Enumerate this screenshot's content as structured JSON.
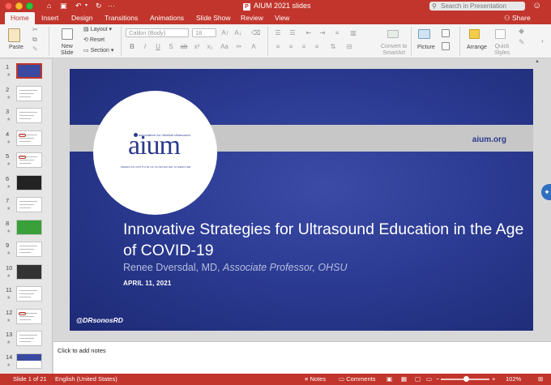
{
  "window": {
    "title": "AIUM 2021 slides",
    "search_placeholder": "Search in Presentation"
  },
  "tabs": [
    "Home",
    "Insert",
    "Design",
    "Transitions",
    "Animations",
    "Slide Show",
    "Review",
    "View"
  ],
  "active_tab": "Home",
  "share_label": "Share",
  "ribbon": {
    "paste": "Paste",
    "new_slide_1": "New",
    "new_slide_2": "Slide",
    "layout": "Layout",
    "reset": "Reset",
    "section": "Section",
    "font_name": "Calibri (Body)",
    "font_size": "18",
    "convert_1": "Convert to",
    "convert_2": "SmartArt",
    "picture": "Picture",
    "arrange": "Arrange",
    "quick_styles_1": "Quick",
    "quick_styles_2": "Styles"
  },
  "slide": {
    "url": "aium.org",
    "logo_tagline": "association for medical ultrasound",
    "logo_text": "aium",
    "logo_subtitle": "AMERICAN INSTITUTE OF ULTRASOUND IN MEDICINE",
    "title": "Innovative Strategies for Ultrasound Education in the Age of COVID-19",
    "author": "Renee Dversdal, MD,",
    "author_role": "Associate Professor, OHSU",
    "date": "APRIL 11, 2021",
    "handle": "@DRsonosRD"
  },
  "thumbnails": [
    "1",
    "2",
    "3",
    "4",
    "5",
    "6",
    "7",
    "8",
    "9",
    "10",
    "11",
    "12",
    "13",
    "14"
  ],
  "notes_placeholder": "Click to add notes",
  "status": {
    "slide_pos": "Slide 1 of 21",
    "language": "English (United States)",
    "notes": "Notes",
    "comments": "Comments",
    "zoom": "102%"
  },
  "colors": {
    "accent": "#c1352c",
    "slide_blue": "#2c3b93",
    "logo_blue": "#2c3a8c"
  }
}
